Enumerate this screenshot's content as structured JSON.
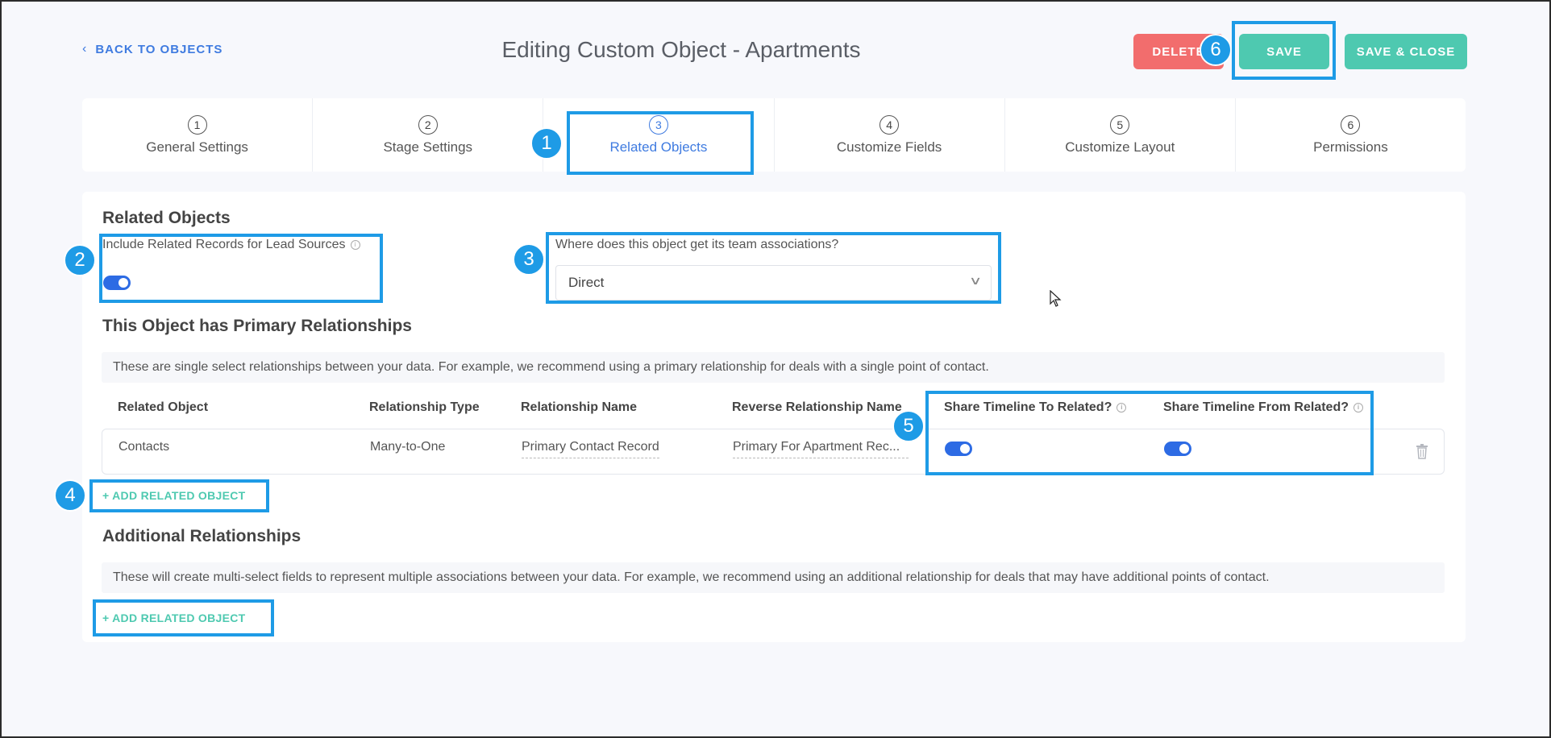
{
  "header": {
    "back_label": "BACK TO OBJECTS",
    "title": "Editing Custom Object - Apartments",
    "delete_label": "DELETE",
    "save_label": "SAVE",
    "save_close_label": "SAVE & CLOSE"
  },
  "tabs": [
    {
      "num": "1",
      "label": "General Settings"
    },
    {
      "num": "2",
      "label": "Stage Settings"
    },
    {
      "num": "3",
      "label": "Related Objects",
      "active": true
    },
    {
      "num": "4",
      "label": "Customize Fields"
    },
    {
      "num": "5",
      "label": "Customize Layout"
    },
    {
      "num": "6",
      "label": "Permissions"
    }
  ],
  "related": {
    "title": "Related Objects",
    "include_label": "Include Related Records for Lead Sources",
    "include_on": true,
    "team_label": "Where does this object get its team associations?",
    "team_value": "Direct"
  },
  "primary": {
    "title": "This Object has Primary Relationships",
    "description": "These are single select relationships between your data. For example, we recommend using a primary relationship for deals with a single point of contact.",
    "columns": [
      "Related Object",
      "Relationship Type",
      "Relationship Name",
      "Reverse Relationship Name",
      "Share Timeline To Related?",
      "Share Timeline From Related?"
    ],
    "rows": [
      {
        "related_object": "Contacts",
        "type": "Many-to-One",
        "name": "Primary Contact Record",
        "reverse": "Primary For Apartment Rec...",
        "share_to": true,
        "share_from": true
      }
    ],
    "add_label": "+ ADD RELATED OBJECT"
  },
  "additional": {
    "title": "Additional Relationships",
    "description": "These will create multi-select fields to represent multiple associations between your data. For example, we recommend using an additional relationship for deals that may have additional points of contact.",
    "add_label": "+ ADD RELATED OBJECT"
  },
  "annotations": [
    "1",
    "2",
    "3",
    "4",
    "5",
    "6"
  ],
  "colors": {
    "accent": "#3f7be0",
    "teal": "#4ec9b0",
    "danger": "#f26d6d",
    "annotation": "#1e9be6",
    "toggle_on": "#2d6be4"
  }
}
